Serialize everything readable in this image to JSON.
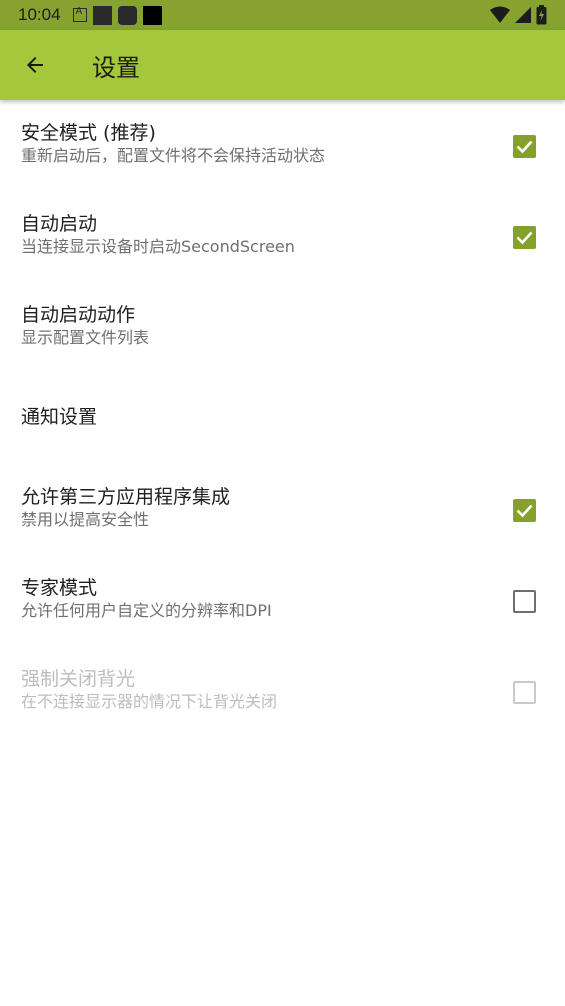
{
  "status_bar": {
    "time": "10:04",
    "icons_left": [
      "android-notification-icon",
      "notification-square-icon",
      "notification-rounded-icon",
      "notification-black-icon"
    ],
    "icons_right": [
      "wifi-icon",
      "signal-icon",
      "battery-charging-icon"
    ]
  },
  "app_bar": {
    "title": "设置",
    "back_icon": "arrow-back-icon",
    "color": "#a4c73b"
  },
  "settings": [
    {
      "title": "安全模式 (推荐)",
      "summary": "重新启动后，配置文件将不会保持活动状态",
      "checkbox": "checked",
      "enabled": true
    },
    {
      "title": "自动启动",
      "summary": "当连接显示设备时启动SecondScreen",
      "checkbox": "checked",
      "enabled": true
    },
    {
      "title": "自动启动动作",
      "summary": "显示配置文件列表",
      "checkbox": "none",
      "enabled": true
    },
    {
      "title": "通知设置",
      "summary": "",
      "checkbox": "none",
      "enabled": true
    },
    {
      "title": "允许第三方应用程序集成",
      "summary": "禁用以提高安全性",
      "checkbox": "checked",
      "enabled": true
    },
    {
      "title": "专家模式",
      "summary": "允许任何用户自定义的分辨率和DPI",
      "checkbox": "unchecked",
      "enabled": true
    },
    {
      "title": "强制关闭背光",
      "summary": "在不连接显示器的情况下让背光关闭",
      "checkbox": "unchecked",
      "enabled": false
    }
  ],
  "colors": {
    "status_bar": "#86a32f",
    "accent": "#85a12b"
  }
}
